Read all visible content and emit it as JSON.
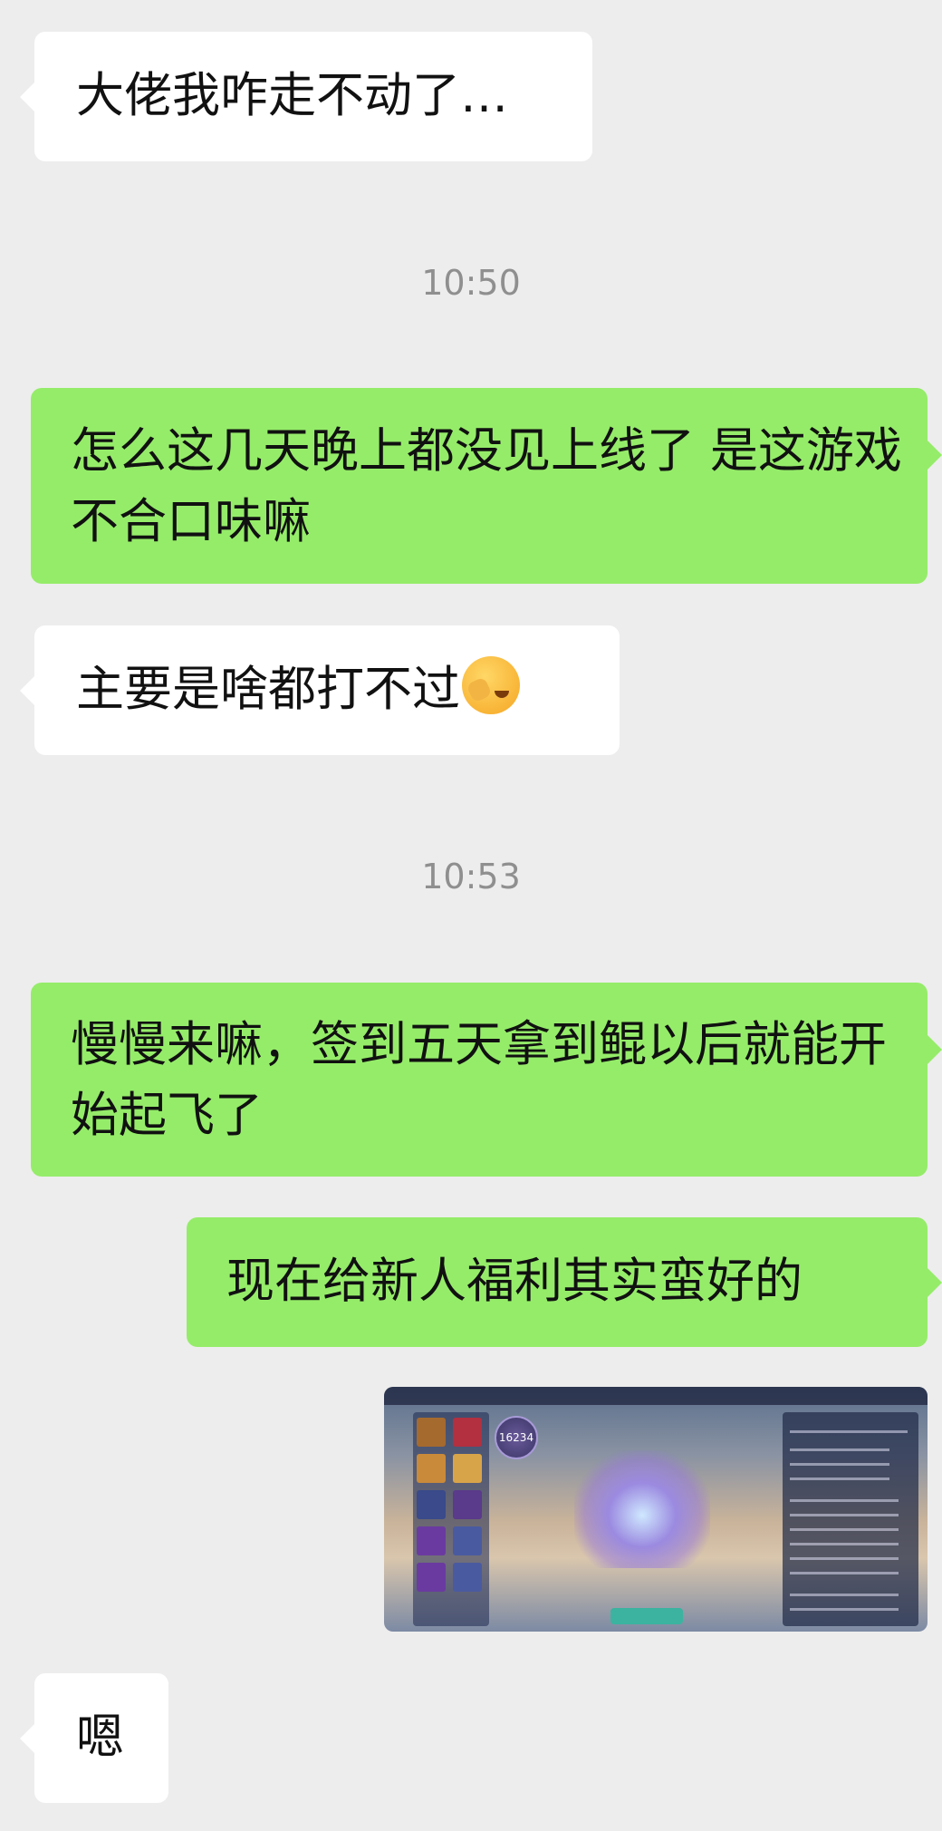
{
  "messages": [
    {
      "side": "in",
      "text": "大佬我咋走不动了…"
    },
    {
      "type": "time",
      "text": "10:50"
    },
    {
      "side": "out",
      "text": "怎么这几天晚上都没见上线了 是这游戏不合口味嘛"
    },
    {
      "side": "in",
      "text": "主要是啥都打不过",
      "emoji": "face-with-hand-over-eyes-crying"
    },
    {
      "type": "time",
      "text": "10:53"
    },
    {
      "side": "out",
      "text": "慢慢来嘛，签到五天拿到鲲以后就能开始起飞了"
    },
    {
      "side": "out",
      "text": "现在给新人福利其实蛮好的"
    },
    {
      "side": "out",
      "type": "image",
      "image": {
        "power_value": "16234"
      }
    },
    {
      "side": "in",
      "text": "嗯"
    }
  ],
  "colors": {
    "background": "#ededed",
    "incoming_bubble": "#ffffff",
    "outgoing_bubble": "#95ec69",
    "timestamp": "#8f8f8f"
  }
}
